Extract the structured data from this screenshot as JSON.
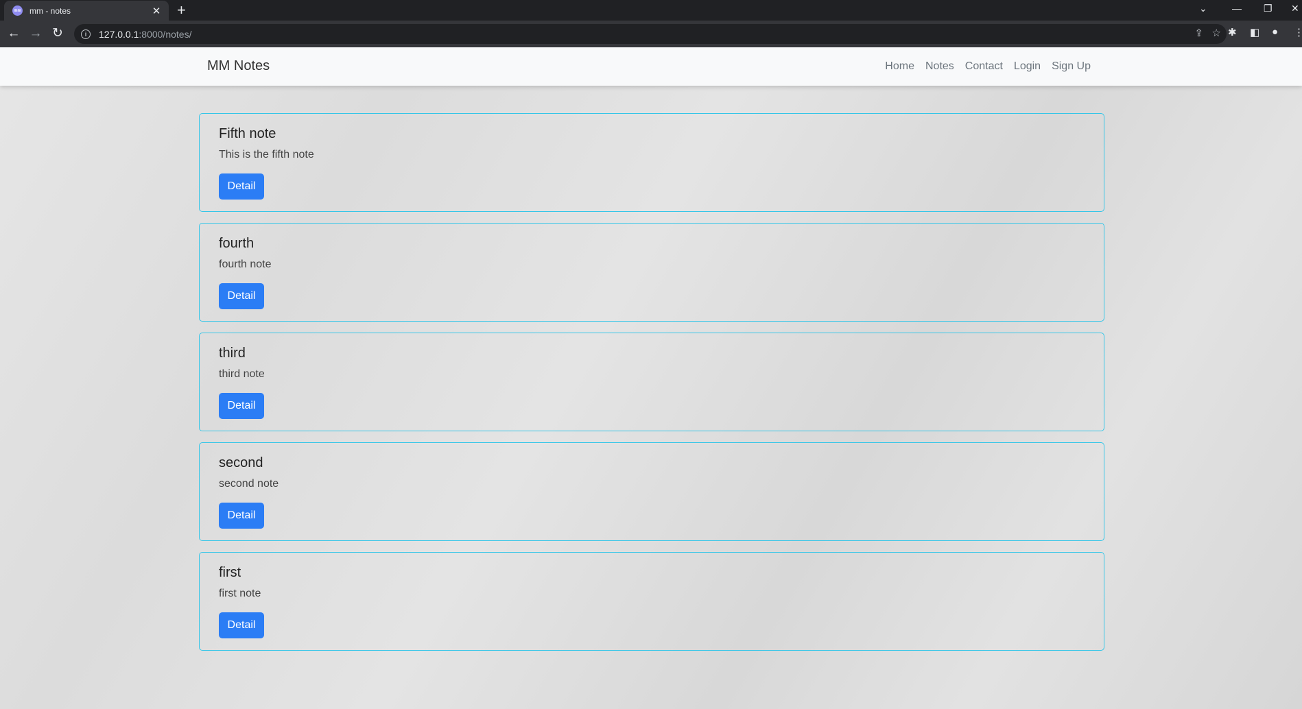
{
  "browser": {
    "tab_title": "mm - notes",
    "favicon_text": "mm",
    "url_host": "127.0.0.1",
    "url_rest": ":8000/notes/"
  },
  "site": {
    "brand": "MM Notes",
    "nav": [
      "Home",
      "Notes",
      "Contact",
      "Login",
      "Sign Up"
    ]
  },
  "notes": [
    {
      "title": "Fifth note",
      "text": "This is the fifth note",
      "button": "Detail"
    },
    {
      "title": "fourth",
      "text": "fourth note",
      "button": "Detail"
    },
    {
      "title": "third",
      "text": "third note",
      "button": "Detail"
    },
    {
      "title": "second",
      "text": "second note",
      "button": "Detail"
    },
    {
      "title": "first",
      "text": "first note",
      "button": "Detail"
    }
  ],
  "colors": {
    "card_border": "#35c6e8",
    "button": "#2b7df5"
  }
}
